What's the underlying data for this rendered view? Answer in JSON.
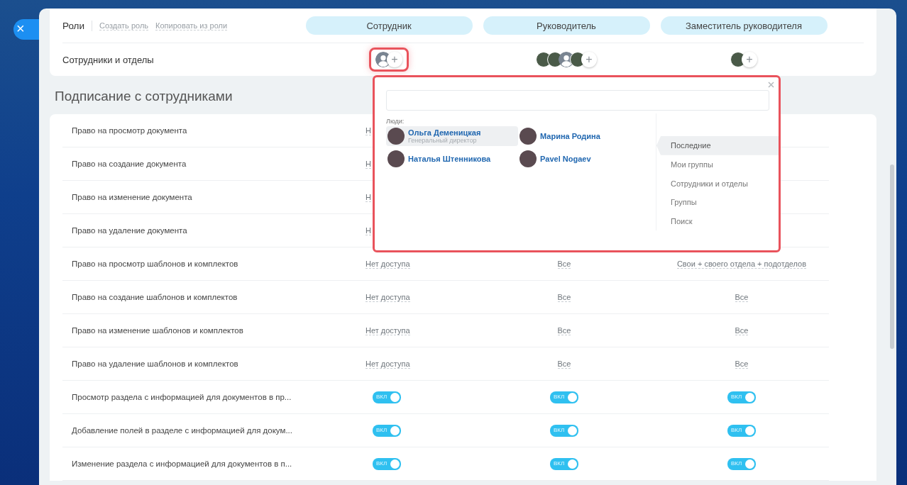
{
  "close_button": {
    "label": "×"
  },
  "roles": {
    "label": "Роли",
    "links": [
      "Создать роль",
      "Копировать из роли"
    ],
    "items": [
      "Сотрудник",
      "Руководитель",
      "Заместитель руководителя"
    ]
  },
  "members": {
    "label": "Сотрудники и отделы",
    "add_label": "+",
    "columns": [
      {
        "highlighted": true,
        "avatars": [
          {
            "kind": "silhouette"
          }
        ]
      },
      {
        "highlighted": false,
        "avatars": [
          {
            "kind": "photo"
          },
          {
            "kind": "photo"
          },
          {
            "kind": "silhouette"
          },
          {
            "kind": "photo"
          }
        ]
      },
      {
        "highlighted": false,
        "avatars": [
          {
            "kind": "photo"
          }
        ]
      }
    ]
  },
  "section_title": "Подписание с сотрудниками",
  "permissions": [
    {
      "label": "Право на просмотр документа",
      "cells": [
        {
          "kind": "text",
          "text": "Н"
        }
      ]
    },
    {
      "label": "Право на создание документа",
      "cells": [
        {
          "kind": "text",
          "text": "Н"
        }
      ]
    },
    {
      "label": "Право на изменение документа",
      "cells": [
        {
          "kind": "text",
          "text": "Н"
        }
      ]
    },
    {
      "label": "Право на удаление документа",
      "cells": [
        {
          "kind": "text",
          "text": "Н"
        }
      ]
    },
    {
      "label": "Право на просмотр шаблонов и комплектов",
      "cells": [
        {
          "kind": "text",
          "text": "Нет доступа"
        },
        {
          "kind": "text",
          "text": "Все"
        },
        {
          "kind": "text",
          "text": "Свои + своего отдела + подотделов"
        }
      ]
    },
    {
      "label": "Право на создание шаблонов и комплектов",
      "cells": [
        {
          "kind": "text",
          "text": "Нет доступа"
        },
        {
          "kind": "text",
          "text": "Все"
        },
        {
          "kind": "text",
          "text": "Все"
        }
      ]
    },
    {
      "label": "Право на изменение шаблонов и комплектов",
      "cells": [
        {
          "kind": "text",
          "text": "Нет доступа"
        },
        {
          "kind": "text",
          "text": "Все"
        },
        {
          "kind": "text",
          "text": "Все"
        }
      ]
    },
    {
      "label": "Право на удаление шаблонов и комплектов",
      "cells": [
        {
          "kind": "text",
          "text": "Нет доступа"
        },
        {
          "kind": "text",
          "text": "Все"
        },
        {
          "kind": "text",
          "text": "Все"
        }
      ]
    },
    {
      "label": "Просмотр раздела с информацией для документов в пр...",
      "cells": [
        {
          "kind": "toggle",
          "text": "ВКЛ",
          "on": true
        },
        {
          "kind": "toggle",
          "text": "ВКЛ",
          "on": true
        },
        {
          "kind": "toggle",
          "text": "ВКЛ",
          "on": true
        }
      ]
    },
    {
      "label": "Добавление полей в разделе с информацией для докум...",
      "cells": [
        {
          "kind": "toggle",
          "text": "ВКЛ",
          "on": true
        },
        {
          "kind": "toggle",
          "text": "ВКЛ",
          "on": true
        },
        {
          "kind": "toggle",
          "text": "ВКЛ",
          "on": true
        }
      ]
    },
    {
      "label": "Изменение раздела с информацией для документов в п...",
      "cells": [
        {
          "kind": "toggle",
          "text": "ВКЛ",
          "on": true
        },
        {
          "kind": "toggle",
          "text": "ВКЛ",
          "on": true
        },
        {
          "kind": "toggle",
          "text": "ВКЛ",
          "on": true
        }
      ]
    }
  ],
  "popup": {
    "highlighted": true,
    "people_label": "Люди:",
    "people": [
      {
        "name": "Ольга Деменицкая",
        "subtitle": "Генеральный директор",
        "selected": true
      },
      {
        "name": "Марина Родина",
        "selected": false
      },
      {
        "name": "Наталья Штенникова",
        "selected": false
      },
      {
        "name": "Pavel Nogaev",
        "selected": false
      }
    ],
    "tabs": [
      {
        "label": "Последние",
        "selected": true
      },
      {
        "label": "Мои группы",
        "selected": false
      },
      {
        "label": "Сотрудники и отделы",
        "selected": false
      },
      {
        "label": "Группы",
        "selected": false
      },
      {
        "label": "Поиск",
        "selected": false
      }
    ]
  }
}
